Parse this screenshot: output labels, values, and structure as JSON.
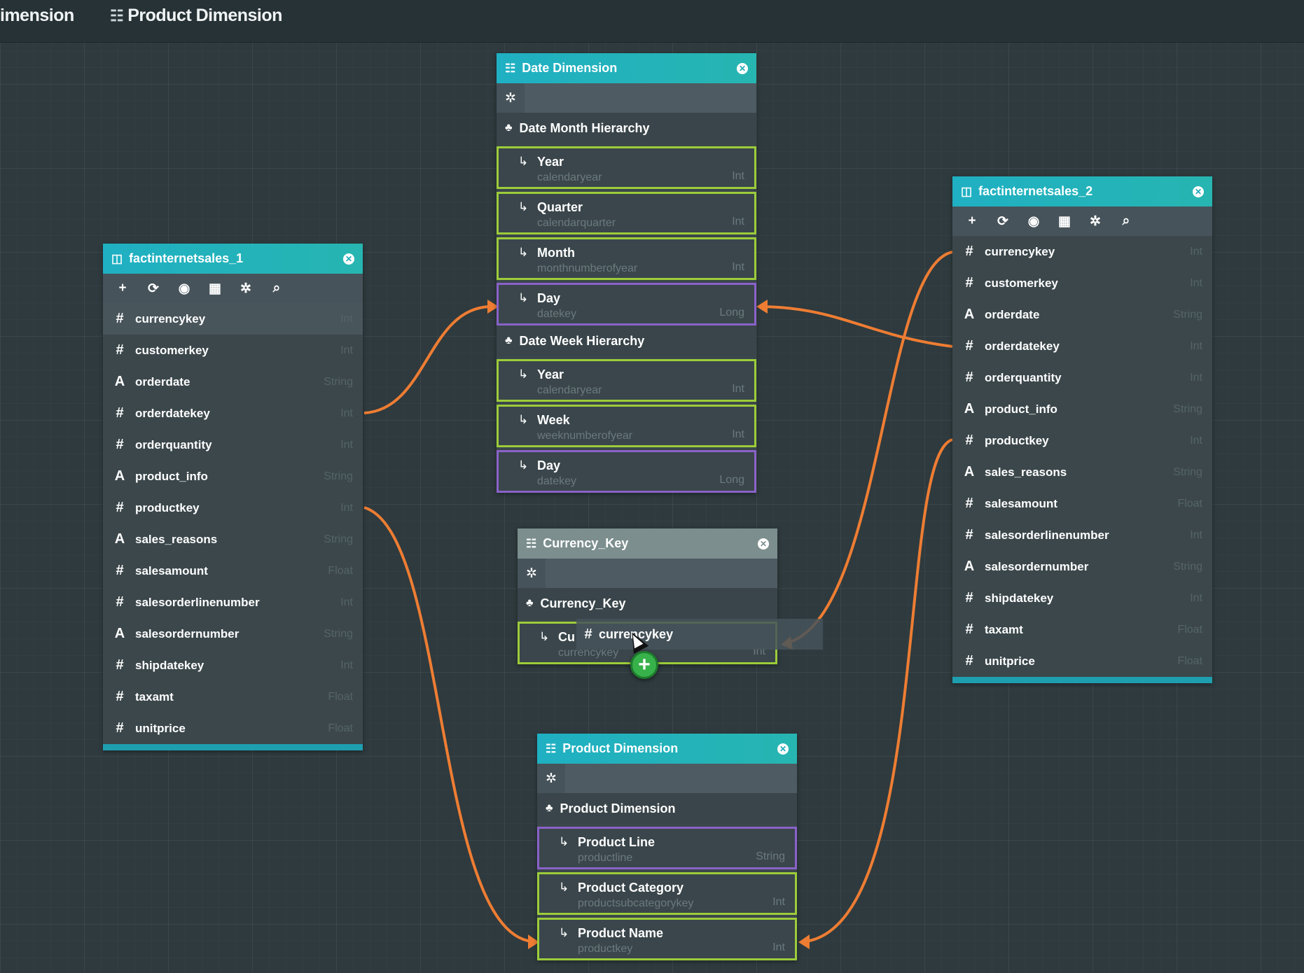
{
  "top_tabs": [
    {
      "label": "imension",
      "icon": "none"
    },
    {
      "label": "Product Dimension",
      "icon": "list-icon"
    }
  ],
  "panels": {
    "date_dimension": {
      "title": "Date Dimension",
      "hierarchies": [
        {
          "name": "Date Month Hierarchy",
          "levels": [
            {
              "name": "Year",
              "column": "calendaryear",
              "type": "Int",
              "border": "green"
            },
            {
              "name": "Quarter",
              "column": "calendarquarter",
              "type": "Int",
              "border": "green"
            },
            {
              "name": "Month",
              "column": "monthnumberofyear",
              "type": "Int",
              "border": "green"
            },
            {
              "name": "Day",
              "column": "datekey",
              "type": "Long",
              "border": "purple"
            }
          ]
        },
        {
          "name": "Date Week Hierarchy",
          "levels": [
            {
              "name": "Year",
              "column": "calendaryear",
              "type": "Int",
              "border": "green"
            },
            {
              "name": "Week",
              "column": "weeknumberofyear",
              "type": "Int",
              "border": "green"
            },
            {
              "name": "Day",
              "column": "datekey",
              "type": "Long",
              "border": "purple"
            }
          ]
        }
      ]
    },
    "currency_key": {
      "title": "Currency_Key",
      "hierarchy": "Currency_Key",
      "level": {
        "name": "Cu",
        "column": "currencykey",
        "type": "Int"
      }
    },
    "product_dimension": {
      "title": "Product Dimension",
      "hierarchy": "Product Dimension",
      "levels": [
        {
          "name": "Product Line",
          "column": "productline",
          "type": "String",
          "border": "purple"
        },
        {
          "name": "Product Category",
          "column": "productsubcategorykey",
          "type": "Int",
          "border": "green"
        },
        {
          "name": "Product Name",
          "column": "productkey",
          "type": "Int",
          "border": "green"
        }
      ]
    },
    "fact1": {
      "title": "factinternetsales_1",
      "fields": [
        {
          "name": "currencykey",
          "type": "Int",
          "kind": "#"
        },
        {
          "name": "customerkey",
          "type": "Int",
          "kind": "#"
        },
        {
          "name": "orderdate",
          "type": "String",
          "kind": "A"
        },
        {
          "name": "orderdatekey",
          "type": "Int",
          "kind": "#"
        },
        {
          "name": "orderquantity",
          "type": "Int",
          "kind": "#"
        },
        {
          "name": "product_info",
          "type": "String",
          "kind": "A"
        },
        {
          "name": "productkey",
          "type": "Int",
          "kind": "#"
        },
        {
          "name": "sales_reasons",
          "type": "String",
          "kind": "A"
        },
        {
          "name": "salesamount",
          "type": "Float",
          "kind": "#"
        },
        {
          "name": "salesorderlinenumber",
          "type": "Int",
          "kind": "#"
        },
        {
          "name": "salesordernumber",
          "type": "String",
          "kind": "A"
        },
        {
          "name": "shipdatekey",
          "type": "Int",
          "kind": "#"
        },
        {
          "name": "taxamt",
          "type": "Float",
          "kind": "#"
        },
        {
          "name": "unitprice",
          "type": "Float",
          "kind": "#"
        }
      ]
    },
    "fact2": {
      "title": "factinternetsales_2",
      "fields": [
        {
          "name": "currencykey",
          "type": "Int",
          "kind": "#"
        },
        {
          "name": "customerkey",
          "type": "Int",
          "kind": "#"
        },
        {
          "name": "orderdate",
          "type": "String",
          "kind": "A"
        },
        {
          "name": "orderdatekey",
          "type": "Int",
          "kind": "#"
        },
        {
          "name": "orderquantity",
          "type": "Int",
          "kind": "#"
        },
        {
          "name": "product_info",
          "type": "String",
          "kind": "A"
        },
        {
          "name": "productkey",
          "type": "Int",
          "kind": "#"
        },
        {
          "name": "sales_reasons",
          "type": "String",
          "kind": "A"
        },
        {
          "name": "salesamount",
          "type": "Float",
          "kind": "#"
        },
        {
          "name": "salesorderlinenumber",
          "type": "Int",
          "kind": "#"
        },
        {
          "name": "salesordernumber",
          "type": "String",
          "kind": "A"
        },
        {
          "name": "shipdatekey",
          "type": "Int",
          "kind": "#"
        },
        {
          "name": "taxamt",
          "type": "Float",
          "kind": "#"
        },
        {
          "name": "unitprice",
          "type": "Float",
          "kind": "#"
        }
      ]
    }
  },
  "drag": {
    "label": "currencykey",
    "kind": "#"
  },
  "colors": {
    "accent_teal": "#1fb0c3",
    "link_orange": "#ee7d33",
    "level_green": "#9ccc3a",
    "level_purple": "#8a62c9",
    "add_green": "#37b14a"
  }
}
